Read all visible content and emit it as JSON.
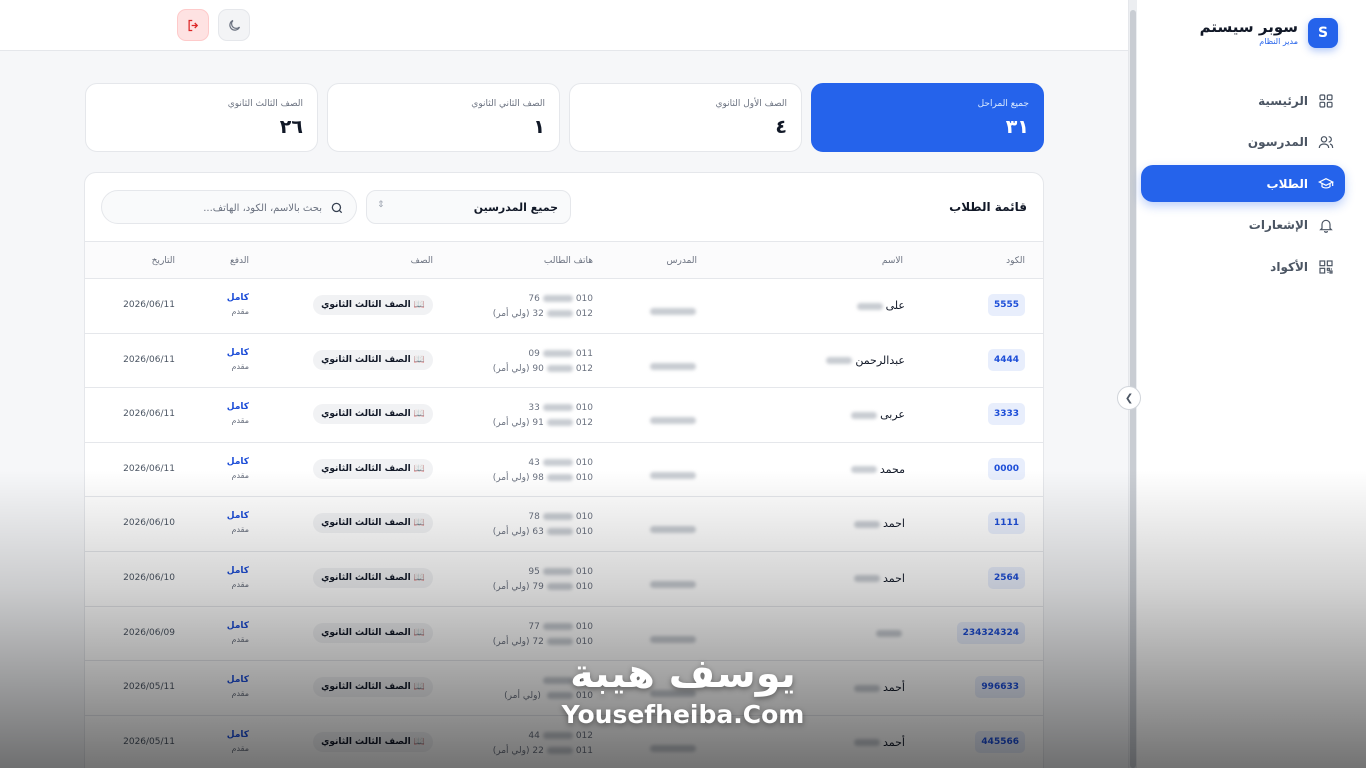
{
  "brand": {
    "logo_letter": "S",
    "name": "سوبر سيستم",
    "role": "مدير النظام"
  },
  "nav": [
    {
      "label": "الرئيسية",
      "icon": "grid-icon"
    },
    {
      "label": "المدرسون",
      "icon": "users-icon"
    },
    {
      "label": "الطلاب",
      "icon": "graduation-cap-icon",
      "active": true
    },
    {
      "label": "الإشعارات",
      "icon": "bell-icon"
    },
    {
      "label": "الأكواد",
      "icon": "qr-code-icon"
    }
  ],
  "stats": [
    {
      "label": "جميع المراحل",
      "value": "٣١"
    },
    {
      "label": "الصف الأول الثانوي",
      "value": "٤"
    },
    {
      "label": "الصف الثاني الثانوي",
      "value": "١"
    },
    {
      "label": "الصف الثالث الثانوي",
      "value": "٢٦"
    }
  ],
  "list": {
    "title": "قائمة الطلاب",
    "teacher_filter": "جميع المدرسين",
    "search_placeholder": "بحث بالاسم، الكود، الهاتف..."
  },
  "table": {
    "columns": [
      "الكود",
      "الاسم",
      "المدرس",
      "هاتف الطالب",
      "الصف",
      "الدفع",
      "التاريخ"
    ],
    "rows": [
      {
        "code": "5555",
        "name": "على",
        "phone_start": "010",
        "phone_end": "76",
        "parent_start": "012",
        "parent_end": "32",
        "grade": "الصف الثالث الثانوي",
        "pay": "كامل",
        "pay_kind": "مقدم",
        "date": "2026/06/11"
      },
      {
        "code": "4444",
        "name": "عبدالرحمن",
        "phone_start": "011",
        "phone_end": "09",
        "parent_start": "012",
        "parent_end": "90",
        "grade": "الصف الثالث الثانوي",
        "pay": "كامل",
        "pay_kind": "مقدم",
        "date": "2026/06/11"
      },
      {
        "code": "3333",
        "name": "عربى",
        "phone_start": "010",
        "phone_end": "33",
        "parent_start": "012",
        "parent_end": "91",
        "grade": "الصف الثالث الثانوي",
        "pay": "كامل",
        "pay_kind": "مقدم",
        "date": "2026/06/11"
      },
      {
        "code": "0000",
        "name": "محمد",
        "phone_start": "010",
        "phone_end": "43",
        "parent_start": "010",
        "parent_end": "98",
        "grade": "الصف الثالث الثانوي",
        "pay": "كامل",
        "pay_kind": "مقدم",
        "date": "2026/06/11"
      },
      {
        "code": "1111",
        "name": "احمد",
        "phone_start": "010",
        "phone_end": "78",
        "parent_start": "010",
        "parent_end": "63",
        "grade": "الصف الثالث الثانوي",
        "pay": "كامل",
        "pay_kind": "مقدم",
        "date": "2026/06/10"
      },
      {
        "code": "2564",
        "name": "احمد",
        "phone_start": "010",
        "phone_end": "95",
        "parent_start": "010",
        "parent_end": "79",
        "grade": "الصف الثالث الثانوي",
        "pay": "كامل",
        "pay_kind": "مقدم",
        "date": "2026/06/10"
      },
      {
        "code": "234324324",
        "name": "",
        "phone_start": "010",
        "phone_end": "77",
        "parent_start": "010",
        "parent_end": "72",
        "grade": "الصف الثالث الثانوي",
        "pay": "كامل",
        "pay_kind": "مقدم",
        "date": "2026/06/09"
      },
      {
        "code": "996633",
        "name": "أحمد",
        "phone_start": "011",
        "phone_end": "",
        "parent_start": "010",
        "parent_end": "",
        "grade": "الصف الثالث الثانوي",
        "pay": "كامل",
        "pay_kind": "مقدم",
        "date": "2026/05/11"
      },
      {
        "code": "445566",
        "name": "أحمد",
        "phone_start": "012",
        "phone_end": "44",
        "parent_start": "011",
        "parent_end": "22",
        "grade": "الصف الثالث الثانوي",
        "pay": "كامل",
        "pay_kind": "مقدم",
        "date": "2026/05/11"
      }
    ],
    "parent_suffix": "(ولي أمر)"
  },
  "watermark": {
    "arabic": "يوسف هيبة",
    "english": "Yousefheiba.Com"
  },
  "colors": {
    "accent": "#2563eb",
    "danger": "#dc2626"
  }
}
